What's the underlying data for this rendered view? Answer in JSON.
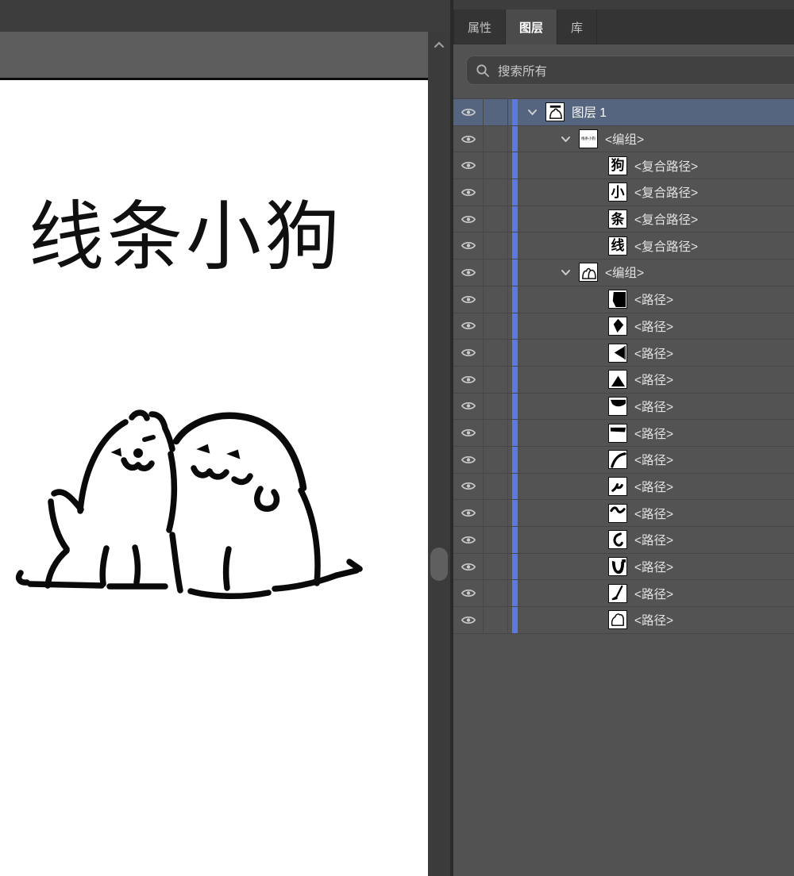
{
  "panel": {
    "tabs": [
      {
        "id": "properties",
        "label": "属性",
        "active": false
      },
      {
        "id": "layers",
        "label": "图层",
        "active": true
      },
      {
        "id": "libraries",
        "label": "库",
        "active": false
      }
    ],
    "search": {
      "placeholder": "搜索所有"
    }
  },
  "canvas": {
    "title": "线条小狗"
  },
  "layers": {
    "accent_color": "#5b79e0",
    "selected_row_color": "#55647f",
    "rows": [
      {
        "label": "图层 1",
        "thumb": "artwork",
        "chevron": true,
        "indent": 0,
        "selected": true
      },
      {
        "label": "<编组>",
        "thumb": "text-group",
        "chevron": true,
        "indent": 1,
        "selected": false
      },
      {
        "label": "<复合路径>",
        "thumb": "char",
        "char": "狗",
        "indent": 2,
        "selected": false
      },
      {
        "label": "<复合路径>",
        "thumb": "char",
        "char": "小",
        "indent": 2,
        "selected": false
      },
      {
        "label": "<复合路径>",
        "thumb": "char",
        "char": "条",
        "indent": 2,
        "selected": false
      },
      {
        "label": "<复合路径>",
        "thumb": "char",
        "char": "线",
        "indent": 2,
        "selected": false
      },
      {
        "label": "<编组>",
        "thumb": "puppy-group",
        "chevron": true,
        "indent": 1,
        "selected": false
      },
      {
        "label": "<路径>",
        "thumb": "shape-1",
        "indent": 2,
        "selected": false
      },
      {
        "label": "<路径>",
        "thumb": "shape-2",
        "indent": 2,
        "selected": false
      },
      {
        "label": "<路径>",
        "thumb": "shape-3",
        "indent": 2,
        "selected": false
      },
      {
        "label": "<路径>",
        "thumb": "shape-4",
        "indent": 2,
        "selected": false
      },
      {
        "label": "<路径>",
        "thumb": "shape-5",
        "indent": 2,
        "selected": false
      },
      {
        "label": "<路径>",
        "thumb": "shape-6",
        "indent": 2,
        "selected": false
      },
      {
        "label": "<路径>",
        "thumb": "shape-7",
        "indent": 2,
        "selected": false
      },
      {
        "label": "<路径>",
        "thumb": "shape-8",
        "indent": 2,
        "selected": false
      },
      {
        "label": "<路径>",
        "thumb": "shape-9",
        "indent": 2,
        "selected": false
      },
      {
        "label": "<路径>",
        "thumb": "shape-10",
        "indent": 2,
        "selected": false
      },
      {
        "label": "<路径>",
        "thumb": "shape-11",
        "indent": 2,
        "selected": false
      },
      {
        "label": "<路径>",
        "thumb": "shape-12",
        "indent": 2,
        "selected": false
      },
      {
        "label": "<路径>",
        "thumb": "shape-13",
        "indent": 2,
        "selected": false
      }
    ]
  }
}
